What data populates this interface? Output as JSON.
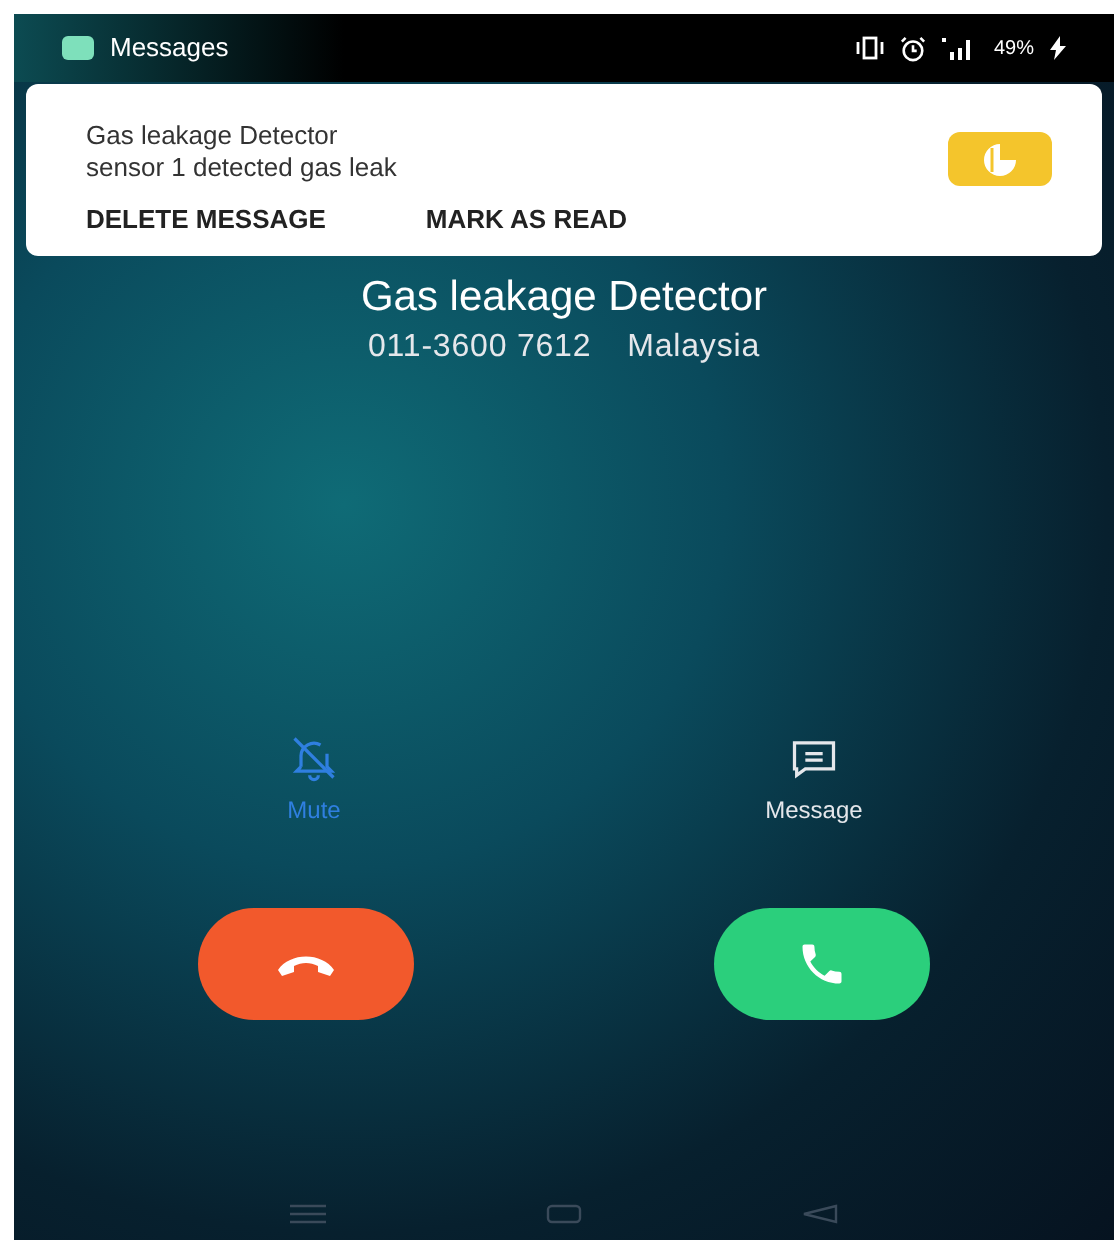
{
  "status_bar": {
    "app_label": "Messages",
    "battery": "49%"
  },
  "notification": {
    "title": "Gas leakage Detector",
    "body": "sensor 1 detected gas leak",
    "actions": [
      "DELETE MESSAGE",
      "MARK AS READ"
    ]
  },
  "caller": {
    "name": "Gas leakage Detector",
    "number": "011-3600 7612",
    "region": "Malaysia"
  },
  "call_options": [
    {
      "kind": "mute",
      "label": "Mute",
      "on": true
    },
    {
      "kind": "message",
      "label": "Message",
      "on": false
    }
  ],
  "call_buttons": [
    {
      "kind": "decline"
    },
    {
      "kind": "answer"
    }
  ]
}
